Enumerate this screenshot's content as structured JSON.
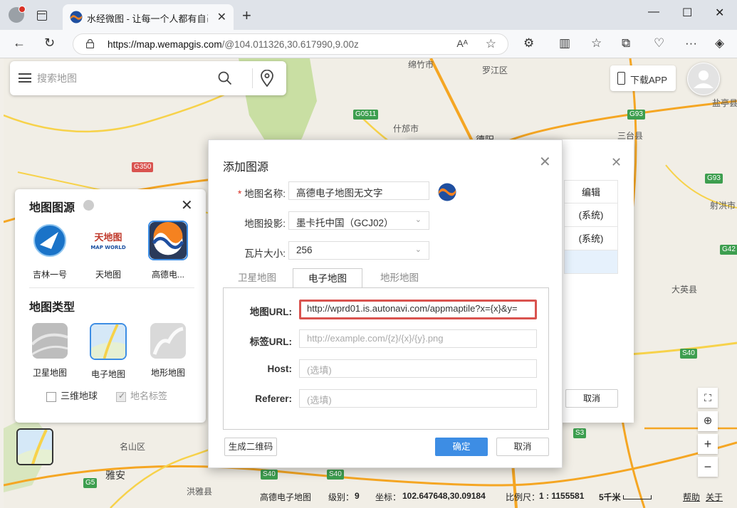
{
  "browser": {
    "tab_title": "水经微图 - 让每一个人都有自己的",
    "url_host": "https://map.wemapgis.com",
    "url_path": "/@104.011326,30.617990,9.00z",
    "read_aloud": "A̅"
  },
  "search": {
    "placeholder": "搜索地图"
  },
  "download_app": "下载APP",
  "map_labels": [
    {
      "text": "绵竹市"
    },
    {
      "text": "罗江区"
    },
    {
      "text": "什邡市"
    },
    {
      "text": "德阳"
    },
    {
      "text": "三台县"
    },
    {
      "text": "射洪市"
    },
    {
      "text": "盐亭县"
    },
    {
      "text": "大英县"
    },
    {
      "text": "名山区"
    },
    {
      "text": "雅安"
    },
    {
      "text": "洪雅县"
    }
  ],
  "road_shields": [
    "G350",
    "G0511",
    "G93",
    "G93",
    "G42",
    "S40",
    "S40",
    "S40",
    "S3",
    "G5"
  ],
  "layer_panel": {
    "source_title": "地图图源",
    "sources": [
      {
        "label": "吉林一号"
      },
      {
        "label": "天地图"
      },
      {
        "label": "高德电..."
      }
    ],
    "type_title": "地图类型",
    "types": [
      {
        "label": "卫星地图"
      },
      {
        "label": "电子地图"
      },
      {
        "label": "地形地图"
      }
    ],
    "globe_3d": "三维地球",
    "place_labels": "地名标签"
  },
  "bg_dialog": {
    "col_header": "编辑",
    "rows": [
      "(系统)",
      "(系统)",
      ""
    ],
    "cancel": "取消"
  },
  "dialog": {
    "title": "添加图源",
    "name_label": "地图名称:",
    "name_value": "高德电子地图无文字",
    "projection_label": "地图投影:",
    "projection_value": "墨卡托中国（GCJ02）",
    "tile_label": "瓦片大小:",
    "tile_value": "256",
    "tabs": [
      "卫星地图",
      "电子地图",
      "地形地图"
    ],
    "map_url_label": "地图URL:",
    "map_url_value": "http://wprd01.is.autonavi.com/appmaptile?x={x}&y=",
    "label_url_label": "标签URL:",
    "label_url_placeholder": "http://example.com/{z}/{x}/{y}.png",
    "host_label": "Host:",
    "host_placeholder": "(选填)",
    "referer_label": "Referer:",
    "referer_placeholder": "(选填)",
    "qr_button": "生成二维码",
    "ok_button": "确定",
    "cancel_button": "取消"
  },
  "status": {
    "map_name": "高德电子地图",
    "level_label": "级别：",
    "level_value": "9",
    "coord_label": "坐标：",
    "coord_value": "102.647648,30.09184",
    "scale_label": "比例尺：",
    "scale_value": "1 : 1155581",
    "distance": "5千米",
    "help": "帮助",
    "about": "关于"
  },
  "colors": {
    "accent": "#3d8de4",
    "highlight_border": "#d9534f",
    "road_orange": "#f5a623",
    "road_yellow": "#f7d24a",
    "green_area": "#c9dfa3"
  }
}
